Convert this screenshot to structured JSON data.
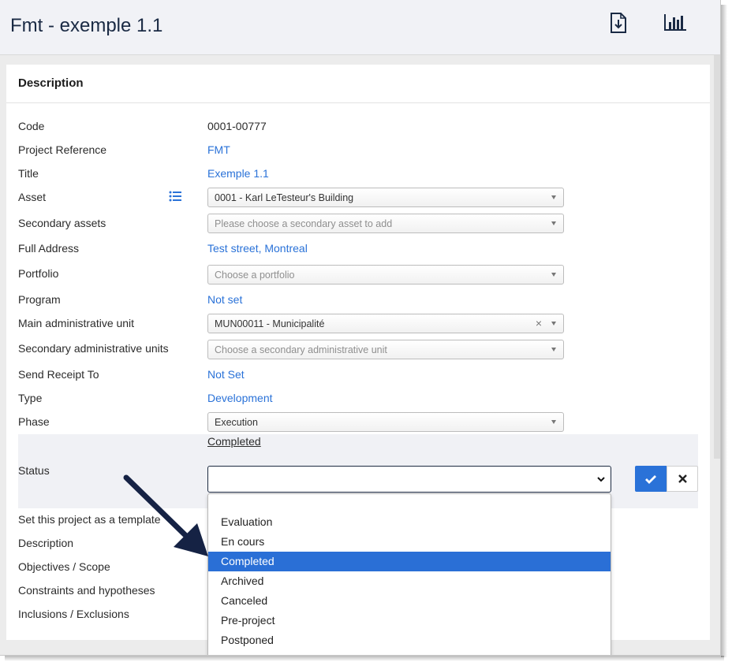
{
  "header": {
    "title": "Fmt - exemple 1.1",
    "icons": [
      "download-file-icon",
      "bar-chart-icon"
    ]
  },
  "card": {
    "title": "Description"
  },
  "fields": {
    "code": {
      "label": "Code",
      "value": "0001-00777"
    },
    "project_reference": {
      "label": "Project Reference",
      "value": "FMT"
    },
    "title": {
      "label": "Title",
      "value": "Exemple 1.1"
    },
    "asset": {
      "label": "Asset",
      "value": "0001 - Karl LeTesteur's Building"
    },
    "secondary_assets": {
      "label": "Secondary assets",
      "placeholder": "Please choose a secondary asset to add"
    },
    "full_address": {
      "label": "Full Address",
      "value": "Test street, Montreal"
    },
    "portfolio": {
      "label": "Portfolio",
      "placeholder": "Choose a portfolio"
    },
    "program": {
      "label": "Program",
      "value": "Not set"
    },
    "main_admin_unit": {
      "label": "Main administrative unit",
      "value": "MUN00011 - Municipalité"
    },
    "secondary_admin_units": {
      "label": "Secondary administrative units",
      "placeholder": "Choose a secondary administrative unit"
    },
    "send_receipt_to": {
      "label": "Send Receipt To",
      "value": "Not Set"
    },
    "type": {
      "label": "Type",
      "value": "Development"
    },
    "phase": {
      "label": "Phase",
      "value": "Execution"
    },
    "status": {
      "label": "Status",
      "current": "Completed",
      "selected": ""
    },
    "template": {
      "label": "Set this project as a template"
    },
    "description": {
      "label": "Description"
    },
    "objectives": {
      "label": "Objectives / Scope"
    },
    "constraints": {
      "label": "Constraints and hypotheses"
    },
    "inclusions": {
      "label": "Inclusions / Exclusions"
    }
  },
  "status_dropdown": {
    "options": [
      "",
      "Evaluation",
      "En cours",
      "Completed",
      "Archived",
      "Canceled",
      "Pre-project",
      "Postponed"
    ],
    "highlighted": "Completed"
  },
  "colors": {
    "accent": "#2a72d8",
    "highlight": "#2a6fd6",
    "arrow": "#152244",
    "title": "#1a2a44"
  }
}
